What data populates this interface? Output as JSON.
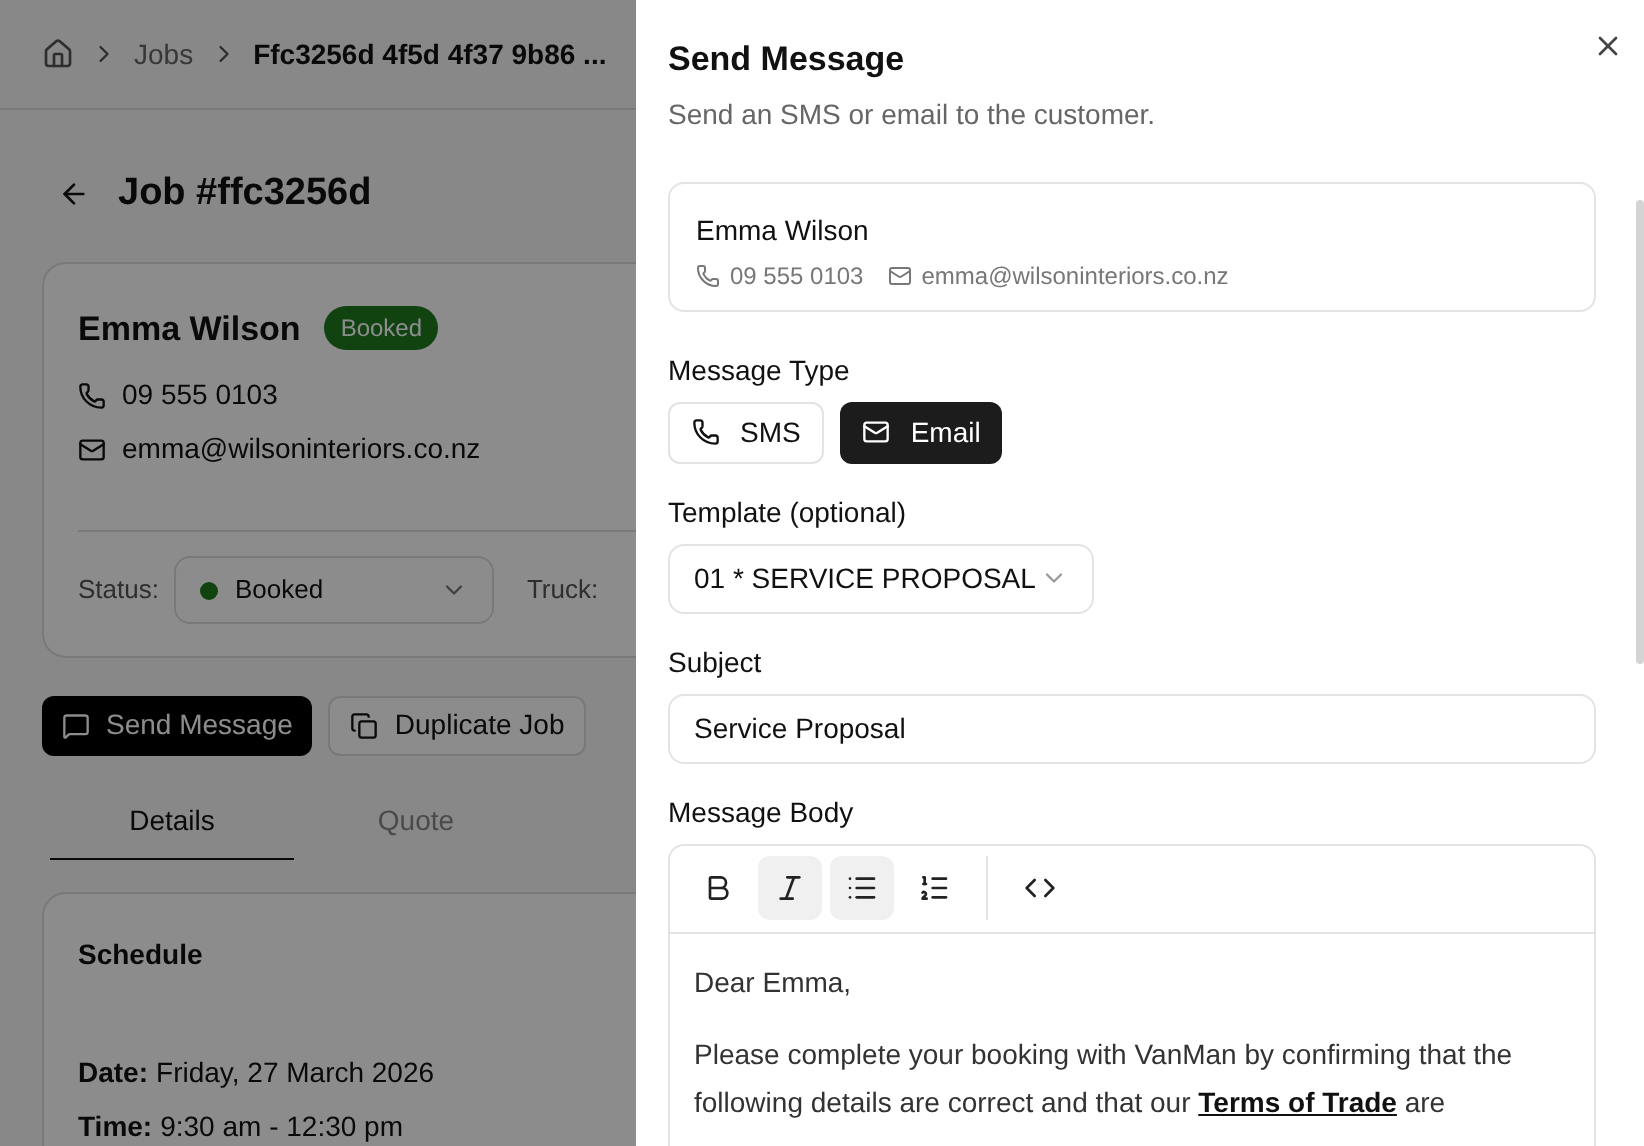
{
  "breadcrumb": {
    "items": [
      {
        "label": "Jobs",
        "current": false
      },
      {
        "label": "Ffc3256d 4f5d 4f37 9b86 ...",
        "current": true
      }
    ]
  },
  "job": {
    "title": "Job #ffc3256d",
    "customer": "Emma Wilson",
    "badge": "Booked",
    "phone": "09 555 0103",
    "email": "emma@wilsoninteriors.co.nz",
    "status_label": "Status:",
    "status_value": "Booked",
    "truck_label": "Truck:"
  },
  "actions": [
    {
      "label": "Send Message",
      "kind": "primary"
    },
    {
      "label": "Duplicate Job",
      "kind": "secondary"
    }
  ],
  "tabs": [
    {
      "label": "Details",
      "selected": true
    },
    {
      "label": "Quote",
      "selected": false
    }
  ],
  "schedule": {
    "title": "Schedule",
    "rows": [
      {
        "label": "Date:",
        "value": "Friday, 27 March 2026"
      },
      {
        "label": "Time:",
        "value": "9:30 am - 12:30 pm"
      }
    ]
  },
  "dialog": {
    "title": "Send Message",
    "subtitle": "Send an SMS or email to the customer.",
    "customer": {
      "name": "Emma Wilson",
      "phone": "09 555 0103",
      "email": "emma@wilsoninteriors.co.nz"
    },
    "message_type": {
      "label": "Message Type",
      "options": [
        {
          "label": "SMS",
          "kind": "sms",
          "selected": false
        },
        {
          "label": "Email",
          "kind": "email",
          "selected": true
        }
      ]
    },
    "template": {
      "label": "Template (optional)",
      "value": "01 * SERVICE PROPOSAL"
    },
    "subject": {
      "label": "Subject",
      "value": "Service Proposal"
    },
    "body": {
      "label": "Message Body",
      "toolbar": [
        {
          "kind": "bold",
          "active": false
        },
        {
          "kind": "italic",
          "active": true
        },
        {
          "kind": "bullet",
          "active": true
        },
        {
          "kind": "ordered",
          "active": false
        },
        {
          "kind": "divider"
        },
        {
          "kind": "code",
          "active": false
        }
      ],
      "greeting": "Dear Emma,",
      "paragraph_start": "Please complete your booking with VanMan by confirming that the following details are correct and that our",
      "link": "Terms of Trade",
      "paragraph_end": "are"
    }
  }
}
